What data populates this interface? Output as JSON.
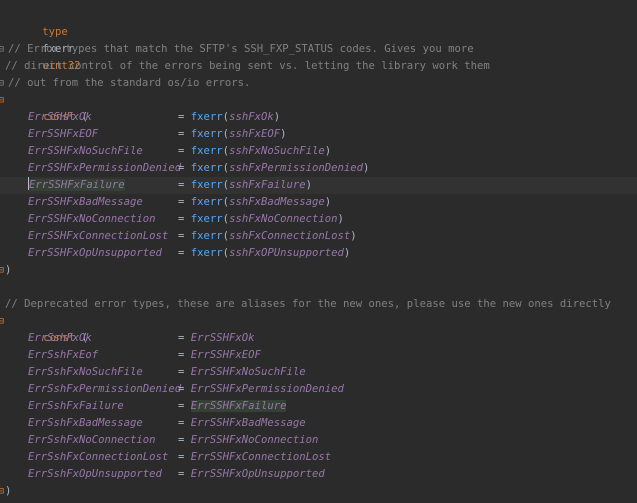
{
  "editor": {
    "line1": {
      "kw": "type",
      "name": "fxerr",
      "type": "uint32"
    },
    "comment1": "// Error types that match the SFTP's SSH_FXP_STATUS codes. Gives you more",
    "comment2": "// direct control of the errors being sent vs. letting the library work them",
    "comment3": "// out from the standard os/io errors.",
    "const_kw": "const",
    "open_paren": "(",
    "close_paren": ")",
    "eq": "=",
    "block1": [
      {
        "name": "ErrSSHFxOk",
        "func": "fxerr",
        "arg": "sshFxOk"
      },
      {
        "name": "ErrSSHFxEOF",
        "func": "fxerr",
        "arg": "sshFxEOF"
      },
      {
        "name": "ErrSSHFxNoSuchFile",
        "func": "fxerr",
        "arg": "sshFxNoSuchFile"
      },
      {
        "name": "ErrSSHFxPermissionDenied",
        "func": "fxerr",
        "arg": "sshFxPermissionDenied"
      },
      {
        "name": "ErrSSHFxFailure",
        "func": "fxerr",
        "arg": "sshFxFailure"
      },
      {
        "name": "ErrSSHFxBadMessage",
        "func": "fxerr",
        "arg": "sshFxBadMessage"
      },
      {
        "name": "ErrSSHFxNoConnection",
        "func": "fxerr",
        "arg": "sshFxNoConnection"
      },
      {
        "name": "ErrSSHFxConnectionLost",
        "func": "fxerr",
        "arg": "sshFxConnectionLost"
      },
      {
        "name": "ErrSSHFxOpUnsupported",
        "func": "fxerr",
        "arg": "sshFxOPUnsupported"
      }
    ],
    "comment4": "// Deprecated error types, these are aliases for the new ones, please use the new ones directly",
    "block2": [
      {
        "name": "ErrSshFxOk",
        "value": "ErrSSHFxOk"
      },
      {
        "name": "ErrSshFxEof",
        "value": "ErrSSHFxEOF"
      },
      {
        "name": "ErrSshFxNoSuchFile",
        "value": "ErrSSHFxNoSuchFile"
      },
      {
        "name": "ErrSshFxPermissionDenied",
        "value": "ErrSSHFxPermissionDenied"
      },
      {
        "name": "ErrSshFxFailure",
        "value": "ErrSSHFxFailure"
      },
      {
        "name": "ErrSshFxBadMessage",
        "value": "ErrSSHFxBadMessage"
      },
      {
        "name": "ErrSshFxNoConnection",
        "value": "ErrSSHFxNoConnection"
      },
      {
        "name": "ErrSshFxConnectionLost",
        "value": "ErrSSHFxConnectionLost"
      },
      {
        "name": "ErrSshFxOpUnsupported",
        "value": "ErrSSHFxOpUnsupported"
      }
    ]
  },
  "colors": {
    "background": "#2b2b2b",
    "keyword": "#cc7832",
    "comment": "#808080",
    "constant": "#9876aa",
    "function": "#56a8f5",
    "text": "#a9b7c6",
    "current_line": "#323232",
    "usage_highlight": "#344134"
  }
}
